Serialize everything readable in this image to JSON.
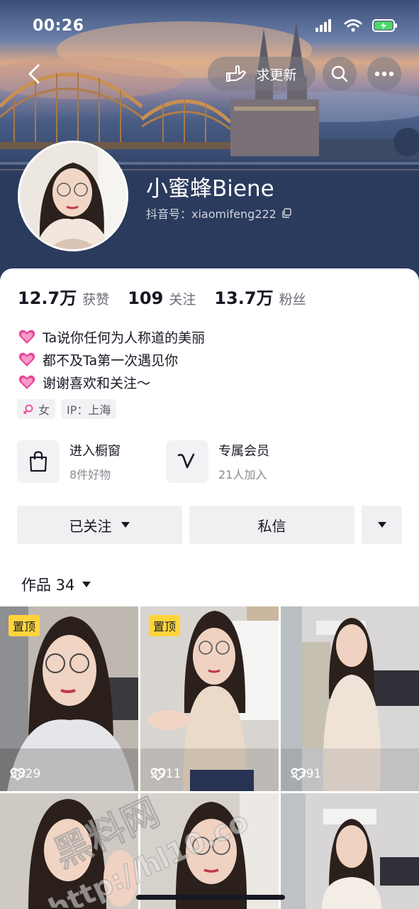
{
  "status_bar": {
    "time": "00:26"
  },
  "header": {
    "update_label": "求更新",
    "nickname": "小蜜蜂Biene",
    "account_id": "抖音号：xiaomifeng222"
  },
  "stats": [
    {
      "value": "12.7万",
      "label": "获赞"
    },
    {
      "value": "109",
      "label": "关注"
    },
    {
      "value": "13.7万",
      "label": "粉丝"
    }
  ],
  "bio": [
    "Ta说你任何为人称道的美丽",
    "都不及Ta第一次遇见你",
    "谢谢喜欢和关注～"
  ],
  "tags": {
    "gender": "女",
    "ip": "IP：上海"
  },
  "entries": {
    "shop": {
      "title": "进入橱窗",
      "sub": "8件好物"
    },
    "member": {
      "title": "专属会员",
      "sub": "21人加入"
    }
  },
  "actions": {
    "follow": "已关注",
    "message": "私信"
  },
  "works": {
    "label": "作品 34"
  },
  "videos": [
    {
      "pinned": "置顶",
      "likes": "3829"
    },
    {
      "pinned": "置顶",
      "likes": "3911"
    },
    {
      "pinned": "",
      "likes": "3391"
    }
  ],
  "watermark": {
    "line1": "黑料网",
    "line2": "http://hl10.co"
  },
  "colors": {
    "accent_pin": "#ffd43b",
    "heart_pink": "#e8479a",
    "banner_dark": "#2a3a5c"
  }
}
